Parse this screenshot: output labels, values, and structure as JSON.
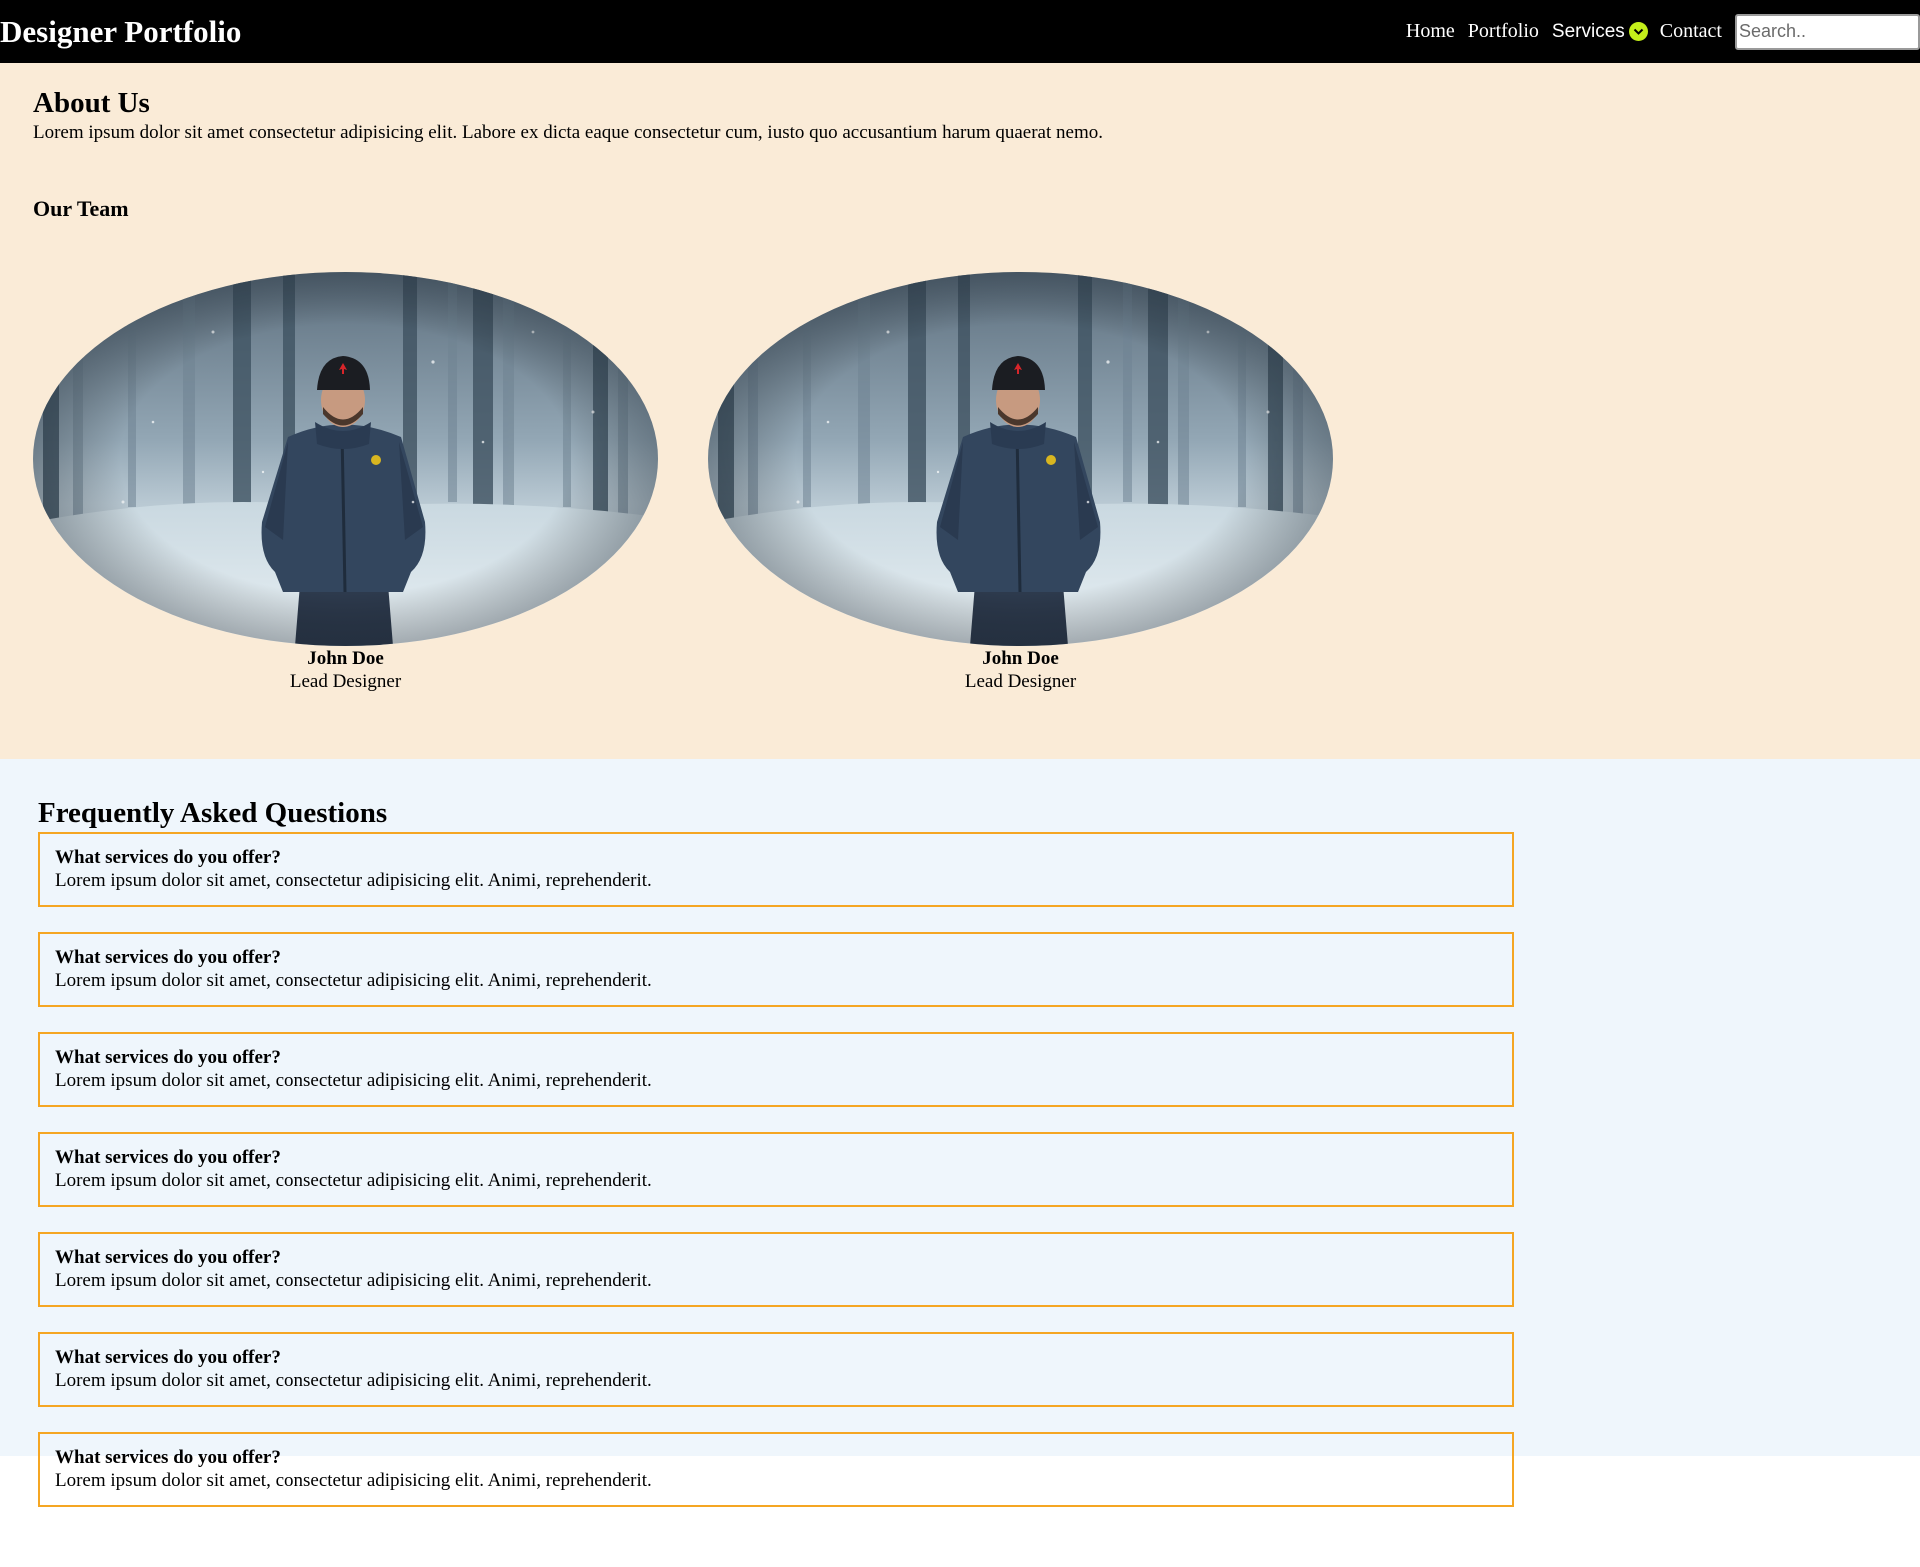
{
  "navbar": {
    "brand": "Designer Portfolio",
    "links": {
      "home": "Home",
      "portfolio": "Portfolio",
      "services": "Services",
      "contact": "Contact"
    },
    "search": {
      "placeholder": "Search..",
      "value": ""
    },
    "colors": {
      "background": "#000000",
      "services_icon": "#c4ef1a"
    }
  },
  "about": {
    "title": "About Us",
    "text": "Lorem ipsum dolor sit amet consectetur adipisicing elit. Labore ex dicta eaque consectetur cum, iusto quo accusantium harum quaerat nemo.",
    "team_title": "Our Team",
    "background": "#faebd7",
    "members": [
      {
        "name": "John Doe",
        "role": "Lead Designer"
      },
      {
        "name": "John Doe",
        "role": "Lead Designer"
      }
    ]
  },
  "faq": {
    "title": "Frequently Asked Questions",
    "background": "#eff6fc",
    "border_color": "#f5a623",
    "items": [
      {
        "question": "What services do you offer?",
        "answer": "Lorem ipsum dolor sit amet, consectetur adipisicing elit. Animi, reprehenderit."
      },
      {
        "question": "What services do you offer?",
        "answer": "Lorem ipsum dolor sit amet, consectetur adipisicing elit. Animi, reprehenderit."
      },
      {
        "question": "What services do you offer?",
        "answer": "Lorem ipsum dolor sit amet, consectetur adipisicing elit. Animi, reprehenderit."
      },
      {
        "question": "What services do you offer?",
        "answer": "Lorem ipsum dolor sit amet, consectetur adipisicing elit. Animi, reprehenderit."
      },
      {
        "question": "What services do you offer?",
        "answer": "Lorem ipsum dolor sit amet, consectetur adipisicing elit. Animi, reprehenderit."
      },
      {
        "question": "What services do you offer?",
        "answer": "Lorem ipsum dolor sit amet, consectetur adipisicing elit. Animi, reprehenderit."
      },
      {
        "question": "What services do you offer?",
        "answer": "Lorem ipsum dolor sit amet, consectetur adipisicing elit. Animi, reprehenderit."
      }
    ]
  }
}
